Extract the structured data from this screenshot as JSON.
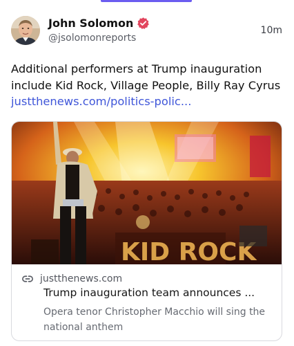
{
  "post": {
    "author_name": "John Solomon",
    "handle": "@jsolomonreports",
    "time": "10m",
    "text": "Additional performers at Trump inauguration include Kid Rock, Village People, Billy Ray Cyrus ",
    "link_text": "justthenews.com/politics-polic..."
  },
  "card": {
    "domain": "justthenews.com",
    "title": "Trump inauguration team announces ...",
    "description": "Opera tenor Christopher Macchio will sing the national anthem",
    "image_stage_text": "KID ROCK"
  },
  "colors": {
    "accent": "#6b5cf0",
    "link": "#3f56d9",
    "verified_badge": "#e2465e"
  },
  "icons": {
    "verified": "verified-badge-icon",
    "link": "link-chain-icon"
  }
}
